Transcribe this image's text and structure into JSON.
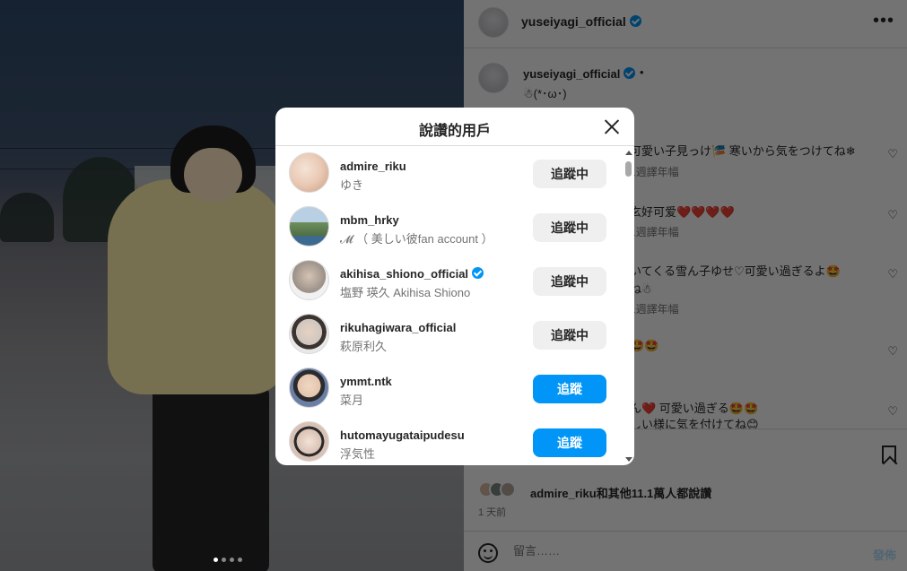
{
  "post": {
    "username": "yuseiyagi_official",
    "caption_separator": "•",
    "caption": "☃(*･ω･)",
    "comments": [
      {
        "text": "可愛い子見っけ🎏 寒いから気をつけてね❄",
        "meta": "1週譯年幅"
      },
      {
        "text": "玄好可爱❤️❤️❤️❤️",
        "meta": "1週譯年幅"
      },
      {
        "text": "いてくる雪ん子ゆせ♡可愛い過ぎるよ🤩",
        "text2": "ね☃",
        "meta": "1週譯年幅"
      },
      {
        "text": "🤩🤩",
        "meta": ""
      },
      {
        "text": "ん❤️ 可愛い過ぎる🤩🤩",
        "text2": "しい様に気を付けてね😊",
        "meta": ""
      }
    ],
    "likes_text": "admire_riku和其他11.1萬人都說讚",
    "time": "1 天前",
    "comment_placeholder": "留言……",
    "post_label": "發佈"
  },
  "modal": {
    "title": "說讚的用戶",
    "users": [
      {
        "username": "admire_riku",
        "name": "ゆき",
        "button": "追蹤中",
        "verified": false,
        "state": "following",
        "avatar_color": "#e9c9b4"
      },
      {
        "username": "mbm_hrky",
        "name": "𝓜 （ 美しい彼fan account ）",
        "button": "追蹤中",
        "verified": false,
        "state": "following",
        "avatar_color": "#6c8f5c"
      },
      {
        "username": "akihisa_shiono_official",
        "name": "塩野 瑛久 Akihisa Shiono",
        "button": "追蹤中",
        "verified": true,
        "state": "following",
        "avatar_color": "#9a8f86"
      },
      {
        "username": "rikuhagiwara_official",
        "name": "萩原利久",
        "button": "追蹤中",
        "verified": false,
        "state": "following",
        "avatar_color": "#cfc6bf"
      },
      {
        "username": "ymmt.ntk",
        "name": "菜月",
        "button": "追蹤",
        "verified": false,
        "state": "follow",
        "avatar_color": "#6b7fa6"
      },
      {
        "username": "hutomayugataipudesu",
        "name": "浮気性",
        "button": "追蹤",
        "verified": false,
        "state": "follow",
        "avatar_color": "#d9c2b5"
      }
    ]
  },
  "colors": {
    "primary_blue": "#0095f6",
    "following_bg": "#efefef",
    "text_main": "#262626",
    "text_muted": "#737373"
  }
}
